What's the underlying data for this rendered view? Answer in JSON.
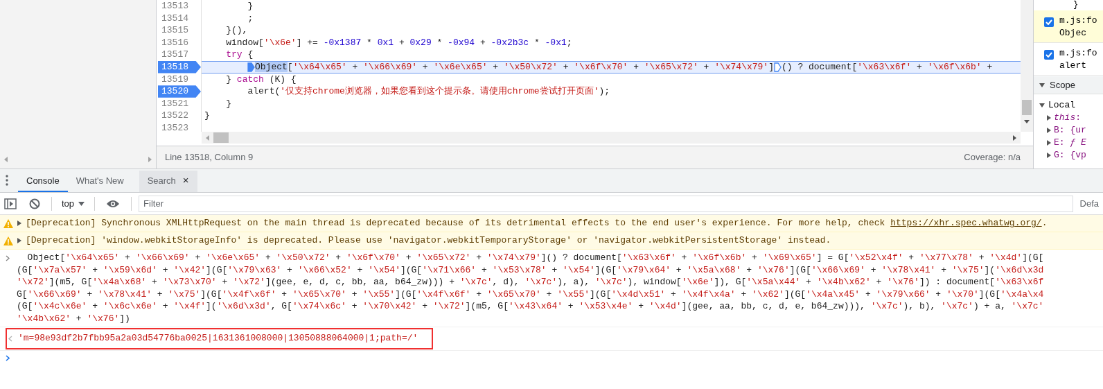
{
  "editor": {
    "code_lines": [
      {
        "number": "13513",
        "breakpoint": false,
        "current": false,
        "tokens": [
          {
            "kind": "plain",
            "text": "        }"
          }
        ]
      },
      {
        "number": "13514",
        "breakpoint": false,
        "current": false,
        "tokens": [
          {
            "kind": "plain",
            "text": "        ;"
          }
        ]
      },
      {
        "number": "13515",
        "breakpoint": false,
        "current": false,
        "tokens": [
          {
            "kind": "plain",
            "text": "    }(),"
          }
        ]
      },
      {
        "number": "13516",
        "breakpoint": false,
        "current": false,
        "tokens": [
          {
            "kind": "plain",
            "text": "    window["
          },
          {
            "kind": "str",
            "text": "'\\x6e'"
          },
          {
            "kind": "plain",
            "text": "] += "
          },
          {
            "kind": "num",
            "text": "-0x1387"
          },
          {
            "kind": "plain",
            "text": " * "
          },
          {
            "kind": "num",
            "text": "0x1"
          },
          {
            "kind": "plain",
            "text": " + "
          },
          {
            "kind": "num",
            "text": "0x29"
          },
          {
            "kind": "plain",
            "text": " * "
          },
          {
            "kind": "num",
            "text": "-0x94"
          },
          {
            "kind": "plain",
            "text": " + "
          },
          {
            "kind": "num",
            "text": "-0x2b3c"
          },
          {
            "kind": "plain",
            "text": " * "
          },
          {
            "kind": "num",
            "text": "-0x1"
          },
          {
            "kind": "plain",
            "text": ";"
          }
        ]
      },
      {
        "number": "13517",
        "breakpoint": false,
        "current": false,
        "tokens": [
          {
            "kind": "kw",
            "text": "    try"
          },
          {
            "kind": "plain",
            "text": " {"
          }
        ]
      },
      {
        "number": "13518",
        "breakpoint": true,
        "current": true,
        "tokens": [
          {
            "kind": "marker",
            "active": true
          },
          {
            "kind": "sel",
            "text": "Object"
          },
          {
            "kind": "plain",
            "text": "["
          },
          {
            "kind": "str",
            "text": "'\\x64\\x65'"
          },
          {
            "kind": "plain",
            "text": " + "
          },
          {
            "kind": "str",
            "text": "'\\x66\\x69'"
          },
          {
            "kind": "plain",
            "text": " + "
          },
          {
            "kind": "str",
            "text": "'\\x6e\\x65'"
          },
          {
            "kind": "plain",
            "text": " + "
          },
          {
            "kind": "str",
            "text": "'\\x50\\x72'"
          },
          {
            "kind": "plain",
            "text": " + "
          },
          {
            "kind": "str",
            "text": "'\\x6f\\x70'"
          },
          {
            "kind": "plain",
            "text": " + "
          },
          {
            "kind": "str",
            "text": "'\\x65\\x72'"
          },
          {
            "kind": "plain",
            "text": " + "
          },
          {
            "kind": "str",
            "text": "'\\x74\\x79'"
          },
          {
            "kind": "plain",
            "text": "]"
          },
          {
            "kind": "marker",
            "active": false
          },
          {
            "kind": "plain",
            "text": "() ? document["
          },
          {
            "kind": "str",
            "text": "'\\x63\\x6f'"
          },
          {
            "kind": "plain",
            "text": " + "
          },
          {
            "kind": "str",
            "text": "'\\x6f\\x6b'"
          },
          {
            "kind": "plain",
            "text": " +"
          }
        ]
      },
      {
        "number": "13519",
        "breakpoint": false,
        "current": false,
        "tokens": [
          {
            "kind": "plain",
            "text": "    } "
          },
          {
            "kind": "kw",
            "text": "catch"
          },
          {
            "kind": "plain",
            "text": " (K) {"
          }
        ]
      },
      {
        "number": "13520",
        "breakpoint": true,
        "current": false,
        "tokens": [
          {
            "kind": "plain",
            "text": "        alert("
          },
          {
            "kind": "str",
            "text": "'仅支持chrome浏览器，如果您看到这个提示条。请使用chrome尝试打开页面'"
          },
          {
            "kind": "plain",
            "text": ");"
          }
        ]
      },
      {
        "number": "13521",
        "breakpoint": false,
        "current": false,
        "tokens": [
          {
            "kind": "plain",
            "text": "    }"
          }
        ]
      },
      {
        "number": "13522",
        "breakpoint": false,
        "current": false,
        "tokens": [
          {
            "kind": "plain",
            "text": "}"
          }
        ]
      },
      {
        "number": "13523",
        "breakpoint": false,
        "current": false
      }
    ],
    "status_bar": {
      "position": "Line 13518, Column 9",
      "coverage": "Coverage: n/a"
    }
  },
  "sidebar": {
    "snippet": "}",
    "breakpoints": [
      {
        "file": "m.js:fo",
        "code": "Objec",
        "checked": true,
        "paused": true
      },
      {
        "file": "m.js:fo",
        "code": "alert",
        "checked": true,
        "paused": false
      }
    ],
    "scope": {
      "title": "Scope",
      "expanded": true,
      "groups": [
        {
          "title": "Local",
          "expanded": true,
          "children": [
            {
              "text": "*this*:",
              "expanded": false
            },
            {
              "text": "B: {ur",
              "expanded": false
            },
            {
              "text": "E: *ƒ E*",
              "expanded": false
            },
            {
              "text": "G: {vp",
              "expanded": false
            }
          ]
        }
      ]
    }
  },
  "drawer": {
    "tabs": [
      {
        "label": "Console",
        "selected": true,
        "highlighted": false,
        "closable": false
      },
      {
        "label": "What's New",
        "selected": false,
        "highlighted": false,
        "closable": false
      },
      {
        "label": "Search",
        "selected": false,
        "highlighted": true,
        "closable": true,
        "close": "×"
      }
    ],
    "toolbar": {
      "context": "top",
      "filter_placeholder": "Filter",
      "levels": "Defa"
    },
    "messages": [
      {
        "kind": "warning",
        "expanded": false,
        "text": "[Deprecation] Synchronous XMLHttpRequest on the main thread is deprecated because of its detrimental effects to the end user's experience. For more help, check ",
        "link": "https://xhr.spec.whatwg.org/",
        "after": "."
      },
      {
        "kind": "warning",
        "expanded": false,
        "text": "[Deprecation] 'window.webkitStorageInfo' is deprecated. Please use 'navigator.webkitTemporaryStorage' or 'navigator.webkitPersistentStorage' instead."
      },
      {
        "kind": "input",
        "lines": [
          {
            "tokens": [
              {
                "kind": "plain",
                "text": "  Object["
              },
              {
                "kind": "str",
                "text": "'\\x64\\x65'"
              },
              {
                "kind": "plain",
                "text": " + "
              },
              {
                "kind": "str",
                "text": "'\\x66\\x69'"
              },
              {
                "kind": "plain",
                "text": " + "
              },
              {
                "kind": "str",
                "text": "'\\x6e\\x65'"
              },
              {
                "kind": "plain",
                "text": " + "
              },
              {
                "kind": "str",
                "text": "'\\x50\\x72'"
              },
              {
                "kind": "plain",
                "text": " + "
              },
              {
                "kind": "str",
                "text": "'\\x6f\\x70'"
              },
              {
                "kind": "plain",
                "text": " + "
              },
              {
                "kind": "str",
                "text": "'\\x65\\x72'"
              },
              {
                "kind": "plain",
                "text": " + "
              },
              {
                "kind": "str",
                "text": "'\\x74\\x79'"
              },
              {
                "kind": "plain",
                "text": "]() ? document["
              },
              {
                "kind": "str",
                "text": "'\\x63\\x6f'"
              },
              {
                "kind": "plain",
                "text": " + "
              },
              {
                "kind": "str",
                "text": "'\\x6f\\x6b'"
              },
              {
                "kind": "plain",
                "text": " + "
              },
              {
                "kind": "str",
                "text": "'\\x69\\x65'"
              },
              {
                "kind": "plain",
                "text": "] = G["
              },
              {
                "kind": "str",
                "text": "'\\x52\\x4f'"
              },
              {
                "kind": "plain",
                "text": " + "
              },
              {
                "kind": "str",
                "text": "'\\x77\\x78'"
              },
              {
                "kind": "plain",
                "text": " + "
              },
              {
                "kind": "str",
                "text": "'\\x4d'"
              },
              {
                "kind": "plain",
                "text": "](G["
              }
            ]
          },
          {
            "tokens": [
              {
                "kind": "plain",
                "text": "(G["
              },
              {
                "kind": "str",
                "text": "'\\x7a\\x57'"
              },
              {
                "kind": "plain",
                "text": " + "
              },
              {
                "kind": "str",
                "text": "'\\x59\\x6d'"
              },
              {
                "kind": "plain",
                "text": " + "
              },
              {
                "kind": "str",
                "text": "'\\x42'"
              },
              {
                "kind": "plain",
                "text": "](G["
              },
              {
                "kind": "str",
                "text": "'\\x79\\x63'"
              },
              {
                "kind": "plain",
                "text": " + "
              },
              {
                "kind": "str",
                "text": "'\\x66\\x52'"
              },
              {
                "kind": "plain",
                "text": " + "
              },
              {
                "kind": "str",
                "text": "'\\x54'"
              },
              {
                "kind": "plain",
                "text": "](G["
              },
              {
                "kind": "str",
                "text": "'\\x71\\x66'"
              },
              {
                "kind": "plain",
                "text": " + "
              },
              {
                "kind": "str",
                "text": "'\\x53\\x78'"
              },
              {
                "kind": "plain",
                "text": " + "
              },
              {
                "kind": "str",
                "text": "'\\x54'"
              },
              {
                "kind": "plain",
                "text": "](G["
              },
              {
                "kind": "str",
                "text": "'\\x79\\x64'"
              },
              {
                "kind": "plain",
                "text": " + "
              },
              {
                "kind": "str",
                "text": "'\\x5a\\x68'"
              },
              {
                "kind": "plain",
                "text": " + "
              },
              {
                "kind": "str",
                "text": "'\\x76'"
              },
              {
                "kind": "plain",
                "text": "](G["
              },
              {
                "kind": "str",
                "text": "'\\x66\\x69'"
              },
              {
                "kind": "plain",
                "text": " + "
              },
              {
                "kind": "str",
                "text": "'\\x78\\x41'"
              },
              {
                "kind": "plain",
                "text": " + "
              },
              {
                "kind": "str",
                "text": "'\\x75'"
              },
              {
                "kind": "plain",
                "text": "]("
              },
              {
                "kind": "str",
                "text": "'\\x6d\\x3d"
              }
            ]
          },
          {
            "tokens": [
              {
                "kind": "str",
                "text": "'\\x72'"
              },
              {
                "kind": "plain",
                "text": "](m5, G["
              },
              {
                "kind": "str",
                "text": "'\\x4a\\x68'"
              },
              {
                "kind": "plain",
                "text": " + "
              },
              {
                "kind": "str",
                "text": "'\\x73\\x70'"
              },
              {
                "kind": "plain",
                "text": " + "
              },
              {
                "kind": "str",
                "text": "'\\x72'"
              },
              {
                "kind": "plain",
                "text": "](gee, e, d, c, bb, aa, b64_zw))) + "
              },
              {
                "kind": "str",
                "text": "'\\x7c'"
              },
              {
                "kind": "plain",
                "text": ", d), "
              },
              {
                "kind": "str",
                "text": "'\\x7c'"
              },
              {
                "kind": "plain",
                "text": "), a), "
              },
              {
                "kind": "str",
                "text": "'\\x7c'"
              },
              {
                "kind": "plain",
                "text": "), window["
              },
              {
                "kind": "str",
                "text": "'\\x6e'"
              },
              {
                "kind": "plain",
                "text": "]), G["
              },
              {
                "kind": "str",
                "text": "'\\x5a\\x44'"
              },
              {
                "kind": "plain",
                "text": " + "
              },
              {
                "kind": "str",
                "text": "'\\x4b\\x62'"
              },
              {
                "kind": "plain",
                "text": " + "
              },
              {
                "kind": "str",
                "text": "'\\x76'"
              },
              {
                "kind": "plain",
                "text": "]) : document["
              },
              {
                "kind": "str",
                "text": "'\\x63\\x6f"
              }
            ]
          },
          {
            "tokens": [
              {
                "kind": "plain",
                "text": "G["
              },
              {
                "kind": "str",
                "text": "'\\x66\\x69'"
              },
              {
                "kind": "plain",
                "text": " + "
              },
              {
                "kind": "str",
                "text": "'\\x78\\x41'"
              },
              {
                "kind": "plain",
                "text": " + "
              },
              {
                "kind": "str",
                "text": "'\\x75'"
              },
              {
                "kind": "plain",
                "text": "](G["
              },
              {
                "kind": "str",
                "text": "'\\x4f\\x6f'"
              },
              {
                "kind": "plain",
                "text": " + "
              },
              {
                "kind": "str",
                "text": "'\\x65\\x70'"
              },
              {
                "kind": "plain",
                "text": " + "
              },
              {
                "kind": "str",
                "text": "'\\x55'"
              },
              {
                "kind": "plain",
                "text": "](G["
              },
              {
                "kind": "str",
                "text": "'\\x4f\\x6f'"
              },
              {
                "kind": "plain",
                "text": " + "
              },
              {
                "kind": "str",
                "text": "'\\x65\\x70'"
              },
              {
                "kind": "plain",
                "text": " + "
              },
              {
                "kind": "str",
                "text": "'\\x55'"
              },
              {
                "kind": "plain",
                "text": "](G["
              },
              {
                "kind": "str",
                "text": "'\\x4d\\x51'"
              },
              {
                "kind": "plain",
                "text": " + "
              },
              {
                "kind": "str",
                "text": "'\\x4f\\x4a'"
              },
              {
                "kind": "plain",
                "text": " + "
              },
              {
                "kind": "str",
                "text": "'\\x62'"
              },
              {
                "kind": "plain",
                "text": "](G["
              },
              {
                "kind": "str",
                "text": "'\\x4a\\x45'"
              },
              {
                "kind": "plain",
                "text": " + "
              },
              {
                "kind": "str",
                "text": "'\\x79\\x66'"
              },
              {
                "kind": "plain",
                "text": " + "
              },
              {
                "kind": "str",
                "text": "'\\x70'"
              },
              {
                "kind": "plain",
                "text": "](G["
              },
              {
                "kind": "str",
                "text": "'\\x4a\\x4"
              }
            ]
          },
          {
            "tokens": [
              {
                "kind": "plain",
                "text": "(G["
              },
              {
                "kind": "str",
                "text": "'\\x4c\\x6e'"
              },
              {
                "kind": "plain",
                "text": " + "
              },
              {
                "kind": "str",
                "text": "'\\x6c\\x6e'"
              },
              {
                "kind": "plain",
                "text": " + "
              },
              {
                "kind": "str",
                "text": "'\\x4f'"
              },
              {
                "kind": "plain",
                "text": "]("
              },
              {
                "kind": "str",
                "text": "'\\x6d\\x3d'"
              },
              {
                "kind": "plain",
                "text": ", G["
              },
              {
                "kind": "str",
                "text": "'\\x74\\x6c'"
              },
              {
                "kind": "plain",
                "text": " + "
              },
              {
                "kind": "str",
                "text": "'\\x70\\x42'"
              },
              {
                "kind": "plain",
                "text": " + "
              },
              {
                "kind": "str",
                "text": "'\\x72'"
              },
              {
                "kind": "plain",
                "text": "](m5, G["
              },
              {
                "kind": "str",
                "text": "'\\x43\\x64'"
              },
              {
                "kind": "plain",
                "text": " + "
              },
              {
                "kind": "str",
                "text": "'\\x53\\x4e'"
              },
              {
                "kind": "plain",
                "text": " + "
              },
              {
                "kind": "str",
                "text": "'\\x4d'"
              },
              {
                "kind": "plain",
                "text": "](gee, aa, bb, c, d, e, b64_zw))), "
              },
              {
                "kind": "str",
                "text": "'\\x7c'"
              },
              {
                "kind": "plain",
                "text": "), b), "
              },
              {
                "kind": "str",
                "text": "'\\x7c'"
              },
              {
                "kind": "plain",
                "text": ") + a, "
              },
              {
                "kind": "str",
                "text": "'\\x7c'"
              }
            ]
          },
          {
            "tokens": [
              {
                "kind": "str",
                "text": "'\\x4b\\x62'"
              },
              {
                "kind": "plain",
                "text": " + "
              },
              {
                "kind": "str",
                "text": "'\\x76'"
              },
              {
                "kind": "plain",
                "text": "])"
              }
            ]
          }
        ]
      },
      {
        "kind": "result",
        "annotated": true,
        "text": "'m=98e93df2b7fbb95a2a03d54776ba0025|1631361008000|13050888064000|1;path=/'"
      },
      {
        "kind": "prompt"
      }
    ]
  }
}
